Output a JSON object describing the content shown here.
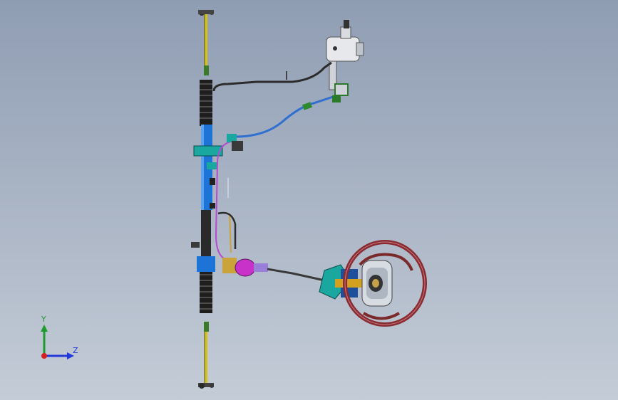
{
  "viewport": {
    "background_top": "#8f9db3",
    "background_bottom": "#c4ccd7"
  },
  "triad": {
    "y_label": "Y",
    "z_label": "Z",
    "y_color": "#1f9a2c",
    "z_color": "#2438d8",
    "x_color": "#d81f1f"
  },
  "model": {
    "rack_color": "#1e73d6",
    "tie_rod_color": "#d4c21a",
    "hose_color": "#2f6fd0",
    "line_color": "#b64ad0",
    "wheel_color": "#8a2b32",
    "pump_color": "#e6e8ec",
    "coupling_color": "#c832c8",
    "bracket_color": "#1aa7a0"
  }
}
